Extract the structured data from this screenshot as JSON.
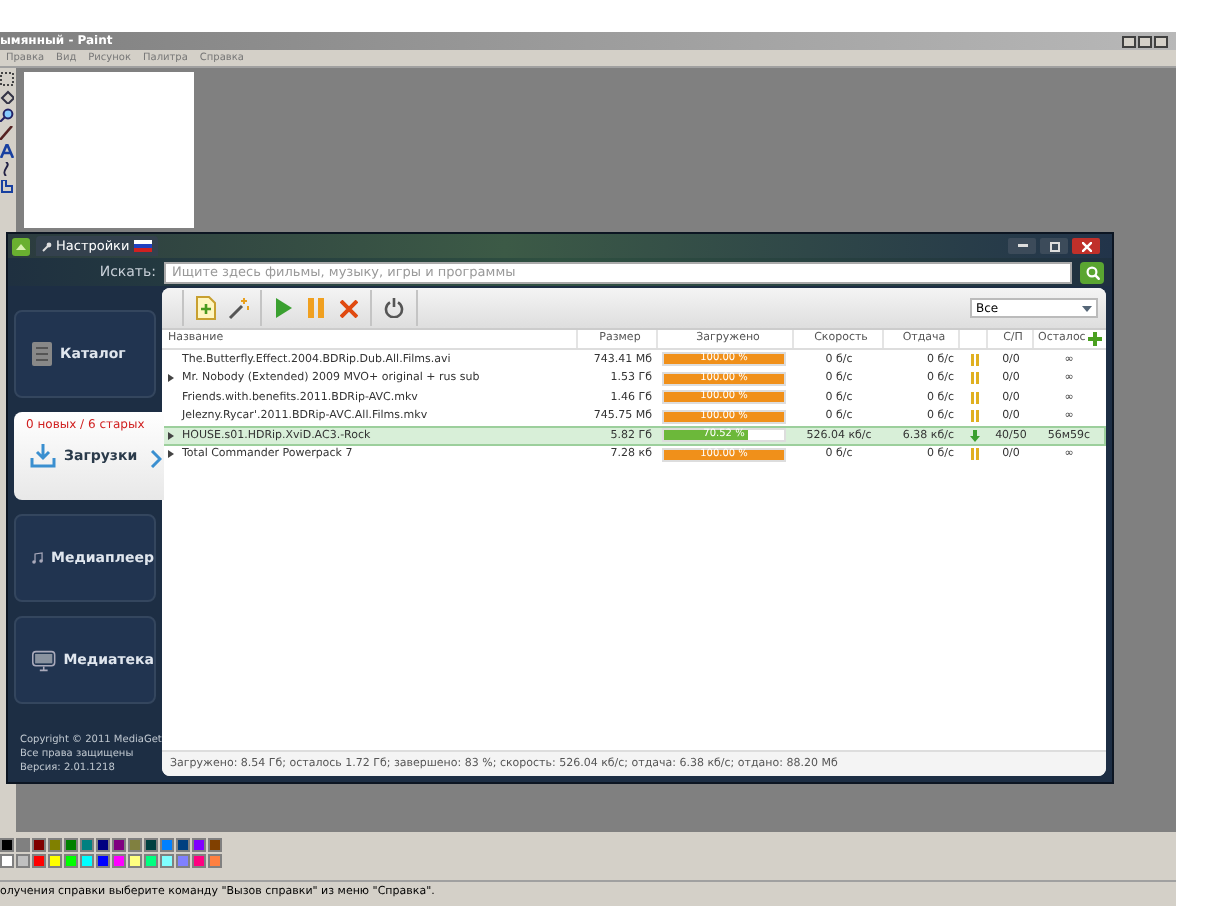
{
  "paint": {
    "title": "ымянный - Paint",
    "menu": [
      "Правка",
      "Вид",
      "Рисунок",
      "Палитра",
      "Справка"
    ],
    "palette": [
      {
        "color": "#000000"
      },
      {
        "color": "#808080"
      },
      {
        "color": "#800000"
      },
      {
        "color": "#808000"
      },
      {
        "color": "#008000"
      },
      {
        "color": "#008080"
      },
      {
        "color": "#000080"
      },
      {
        "color": "#800080"
      },
      {
        "color": "#808040"
      },
      {
        "color": "#004040"
      },
      {
        "color": "#0080ff"
      },
      {
        "color": "#004080"
      },
      {
        "color": "#8000ff"
      },
      {
        "color": "#804000"
      },
      {
        "color": "#ffffff"
      },
      {
        "color": "#c0c0c0"
      },
      {
        "color": "#ff0000"
      },
      {
        "color": "#ffff00"
      },
      {
        "color": "#00ff00"
      },
      {
        "color": "#00ffff"
      },
      {
        "color": "#0000ff"
      },
      {
        "color": "#ff00ff"
      },
      {
        "color": "#ffff80"
      },
      {
        "color": "#00ff80"
      },
      {
        "color": "#80ffff"
      },
      {
        "color": "#8080ff"
      },
      {
        "color": "#ff0080"
      },
      {
        "color": "#ff8040"
      }
    ],
    "status": "олучения справки выберите команду \"Вызов справки\" из меню \"Справка\"."
  },
  "mediaget": {
    "settings_tab": "Настройки",
    "search": {
      "label": "Искать:",
      "placeholder": "Ищите здесь фильмы, музыку, игры и программы"
    },
    "sidebar": [
      {
        "label": "Каталог",
        "kind": "catalog",
        "selected": false
      },
      {
        "label": "Загрузки",
        "kind": "downloads",
        "selected": true,
        "badge": "0 новых / 6 старых"
      },
      {
        "label": "Медиаплеер",
        "kind": "player",
        "selected": false
      },
      {
        "label": "Медиатека",
        "kind": "library",
        "selected": false
      }
    ],
    "copyright": [
      "Copyright © 2011 MediaGet",
      "Все права защищены",
      "Версия: 2.01.1218"
    ],
    "filter": "Все",
    "columns": [
      "Название",
      "Размер",
      "Загружено",
      "Скорость",
      "Отдача",
      "С/П",
      "Осталос"
    ],
    "rows": [
      {
        "name": "The.Butterfly.Effect.2004.BDRip.Dub.All.Films.avi",
        "expandable": false,
        "size": "743.41 Мб",
        "progress": "100.00 %",
        "level": 1,
        "speed": "0 б/с",
        "upload": "0 б/с",
        "kind": "paused",
        "peers": "0/0",
        "remaining": "∞",
        "selected": false
      },
      {
        "name": "Mr. Nobody (Extended) 2009 MVO+ original + rus sub",
        "expandable": true,
        "size": "1.53 Гб",
        "progress": "100.00 %",
        "level": 1,
        "speed": "0 б/с",
        "upload": "0 б/с",
        "kind": "paused",
        "peers": "0/0",
        "remaining": "∞",
        "selected": false
      },
      {
        "name": "Friends.with.benefits.2011.BDRip-AVC.mkv",
        "expandable": false,
        "size": "1.46 Гб",
        "progress": "100.00 %",
        "level": 1,
        "speed": "0 б/с",
        "upload": "0 б/с",
        "kind": "paused",
        "peers": "0/0",
        "remaining": "∞",
        "selected": false
      },
      {
        "name": "Jelezny.Rycar'.2011.BDRip-AVC.All.Films.mkv",
        "expandable": false,
        "size": "745.75 Мб",
        "progress": "100.00 %",
        "level": 1,
        "speed": "0 б/с",
        "upload": "0 б/с",
        "kind": "paused",
        "peers": "0/0",
        "remaining": "∞",
        "selected": false
      },
      {
        "name": "HOUSE.s01.HDRip.XviD.AC3.-Rock",
        "expandable": true,
        "size": "5.82 Гб",
        "progress": "70.52 %",
        "level": 0.7052,
        "speed": "526.04 кб/с",
        "upload": "6.38 кб/с",
        "kind": "downloading",
        "peers": "40/50",
        "remaining": "56м59с",
        "selected": true
      },
      {
        "name": "Total Commander Powerpack 7",
        "expandable": true,
        "size": "7.28 кб",
        "progress": "100.00 %",
        "level": 1,
        "speed": "0 б/с",
        "upload": "0 б/с",
        "kind": "paused",
        "peers": "0/0",
        "remaining": "∞",
        "selected": false
      }
    ],
    "status": "Загружено: 8.54 Гб; осталось 1.72 Гб; завершено: 83 %; скорость: 526.04 кб/с; отдача: 6.38 кб/с; отдано: 88.20 Мб"
  }
}
